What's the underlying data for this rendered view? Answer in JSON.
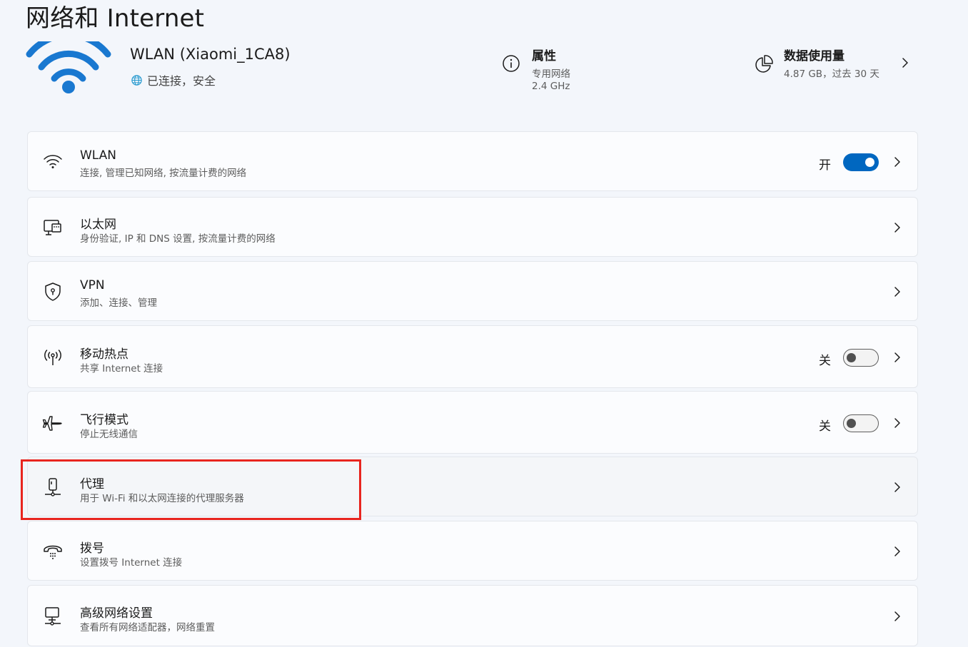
{
  "page": {
    "title": "网络和 Internet"
  },
  "header": {
    "network_name": "WLAN (Xiaomi_1CA8)",
    "status": "已连接，安全",
    "properties": {
      "title": "属性",
      "line1": "专用网络",
      "line2": "2.4 GHz",
      "icon": "info-icon"
    },
    "data_usage": {
      "title": "数据使用量",
      "subtitle": "4.87 GB，过去 30 天",
      "icon": "pie-chart-icon"
    }
  },
  "settings": [
    {
      "id": "wlan",
      "icon": "wifi-icon",
      "title": "WLAN",
      "subtitle": "连接, 管理已知网络, 按流量计费的网络",
      "toggle": "on",
      "state": "开"
    },
    {
      "id": "ethernet",
      "icon": "ethernet-icon",
      "title": "以太网",
      "subtitle": "身份验证, IP 和 DNS 设置, 按流量计费的网络"
    },
    {
      "id": "vpn",
      "icon": "shield-icon",
      "title": "VPN",
      "subtitle": "添加、连接、管理"
    },
    {
      "id": "hotspot",
      "icon": "hotspot-icon",
      "title": "移动热点",
      "subtitle": "共享 Internet 连接",
      "toggle": "off",
      "state": "关"
    },
    {
      "id": "airplane",
      "icon": "airplane-icon",
      "title": "飞行模式",
      "subtitle": "停止无线通信",
      "toggle": "off",
      "state": "关"
    },
    {
      "id": "proxy",
      "icon": "proxy-icon",
      "title": "代理",
      "subtitle": "用于 Wi-Fi 和以太网连接的代理服务器"
    },
    {
      "id": "dialup",
      "icon": "dialup-icon",
      "title": "拨号",
      "subtitle": "设置拨号 Internet 连接"
    },
    {
      "id": "advanced",
      "icon": "computer-network-icon",
      "title": "高级网络设置",
      "subtitle": "查看所有网络适配器，网络重置"
    }
  ],
  "colors": {
    "accent": "#0067c0",
    "highlight": "#e8251f",
    "background": "#f3f6fb"
  }
}
